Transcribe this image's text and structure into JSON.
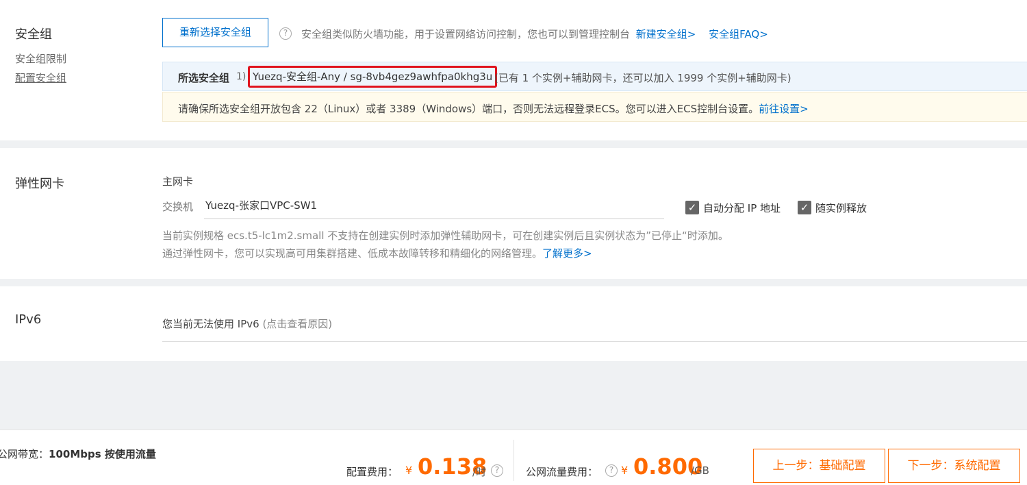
{
  "security_group": {
    "title": "安全组",
    "side_links": [
      "安全组限制",
      "配置安全组"
    ],
    "reselect_button": "重新选择安全组",
    "help_glyph": "?",
    "description": "安全组类似防火墙功能，用于设置网络访问控制，您也可以到管理控制台",
    "new_sg_link": "新建安全组>",
    "faq_link": "安全组FAQ>",
    "selected_label": "所选安全组",
    "selected_index": "1)",
    "selected_value": "Yuezq-安全组-Any / sg-8vb4gez9awhfpa0khg3u",
    "selected_extra": "(已有 1 个实例+辅助网卡，还可以加入 1999 个实例+辅助网卡)",
    "warning_text": "请确保所选安全组开放包含 22（Linux）或者 3389（Windows）端口，否则无法远程登录ECS。您可以进入ECS控制台设置。",
    "warning_link": "前往设置>",
    "highlight_color": "#e0141e"
  },
  "eni": {
    "title": "弹性网卡",
    "primary_label": "主网卡",
    "switch_label": "交换机",
    "switch_value": "Yuezq-张家口VPC-SW1",
    "checkboxes": [
      {
        "label": "自动分配 IP 地址",
        "checked": true
      },
      {
        "label": "随实例释放",
        "checked": true
      }
    ],
    "check_glyph": "✓",
    "note_line1": "当前实例规格 ecs.t5-lc1m2.small 不支持在创建实例时添加弹性辅助网卡，可在创建实例后且实例状态为”已停止“时添加。",
    "note_line2": "通过弹性网卡，您可以实现高可用集群搭建、低成本故障转移和精细化的网络管理。",
    "learn_more": "了解更多>"
  },
  "ipv6": {
    "title": "IPv6",
    "text": "您当前无法使用 IPv6",
    "reason": "(点击查看原因)"
  },
  "footer": {
    "bandwidth_label": "公网带宽：",
    "bandwidth_value": "100Mbps 按使用流量",
    "config_fee_label": "配置费用：",
    "currency": "¥",
    "config_fee_value": "0.138",
    "config_fee_unit": "/时",
    "traffic_fee_label": "公网流量费用：",
    "traffic_fee_value": "0.800",
    "traffic_fee_unit": "/GB",
    "prev_button": "上一步：基础配置",
    "next_button": "下一步：系统配置",
    "accent_color": "#ff6a00"
  }
}
